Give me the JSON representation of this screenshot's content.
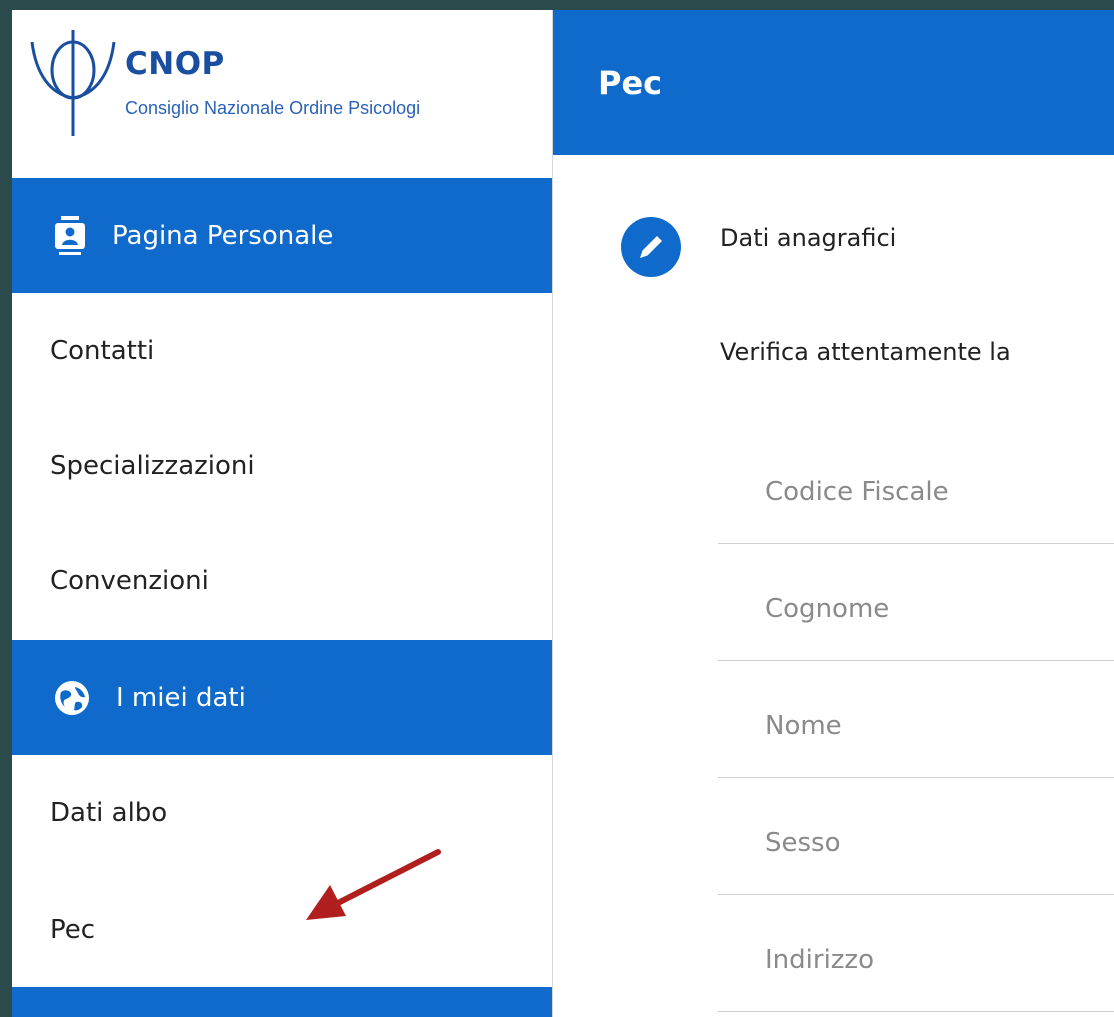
{
  "logo": {
    "title": "CNOP",
    "subtitle": "Consiglio Nazionale Ordine Psicologi"
  },
  "sidebar": {
    "sections": [
      {
        "label": "Pagina Personale",
        "icon": "id-badge-icon",
        "items": [
          "Contatti",
          "Specializzazioni",
          "Convenzioni"
        ]
      },
      {
        "label": "I miei dati",
        "icon": "globe-icon",
        "items": [
          "Dati albo",
          "Pec"
        ]
      }
    ]
  },
  "main": {
    "header_title": "Pec",
    "section_title": "Dati anagrafici",
    "section_icon": "pencil-icon",
    "verify_text": "Verifica attentamente la",
    "fields": [
      "Codice Fiscale",
      "Cognome",
      "Nome",
      "Sesso",
      "Indirizzo"
    ]
  },
  "colors": {
    "primary": "#0f6acb",
    "annotation_arrow": "#b01e1e",
    "outer_background": "#2b4a4c"
  }
}
